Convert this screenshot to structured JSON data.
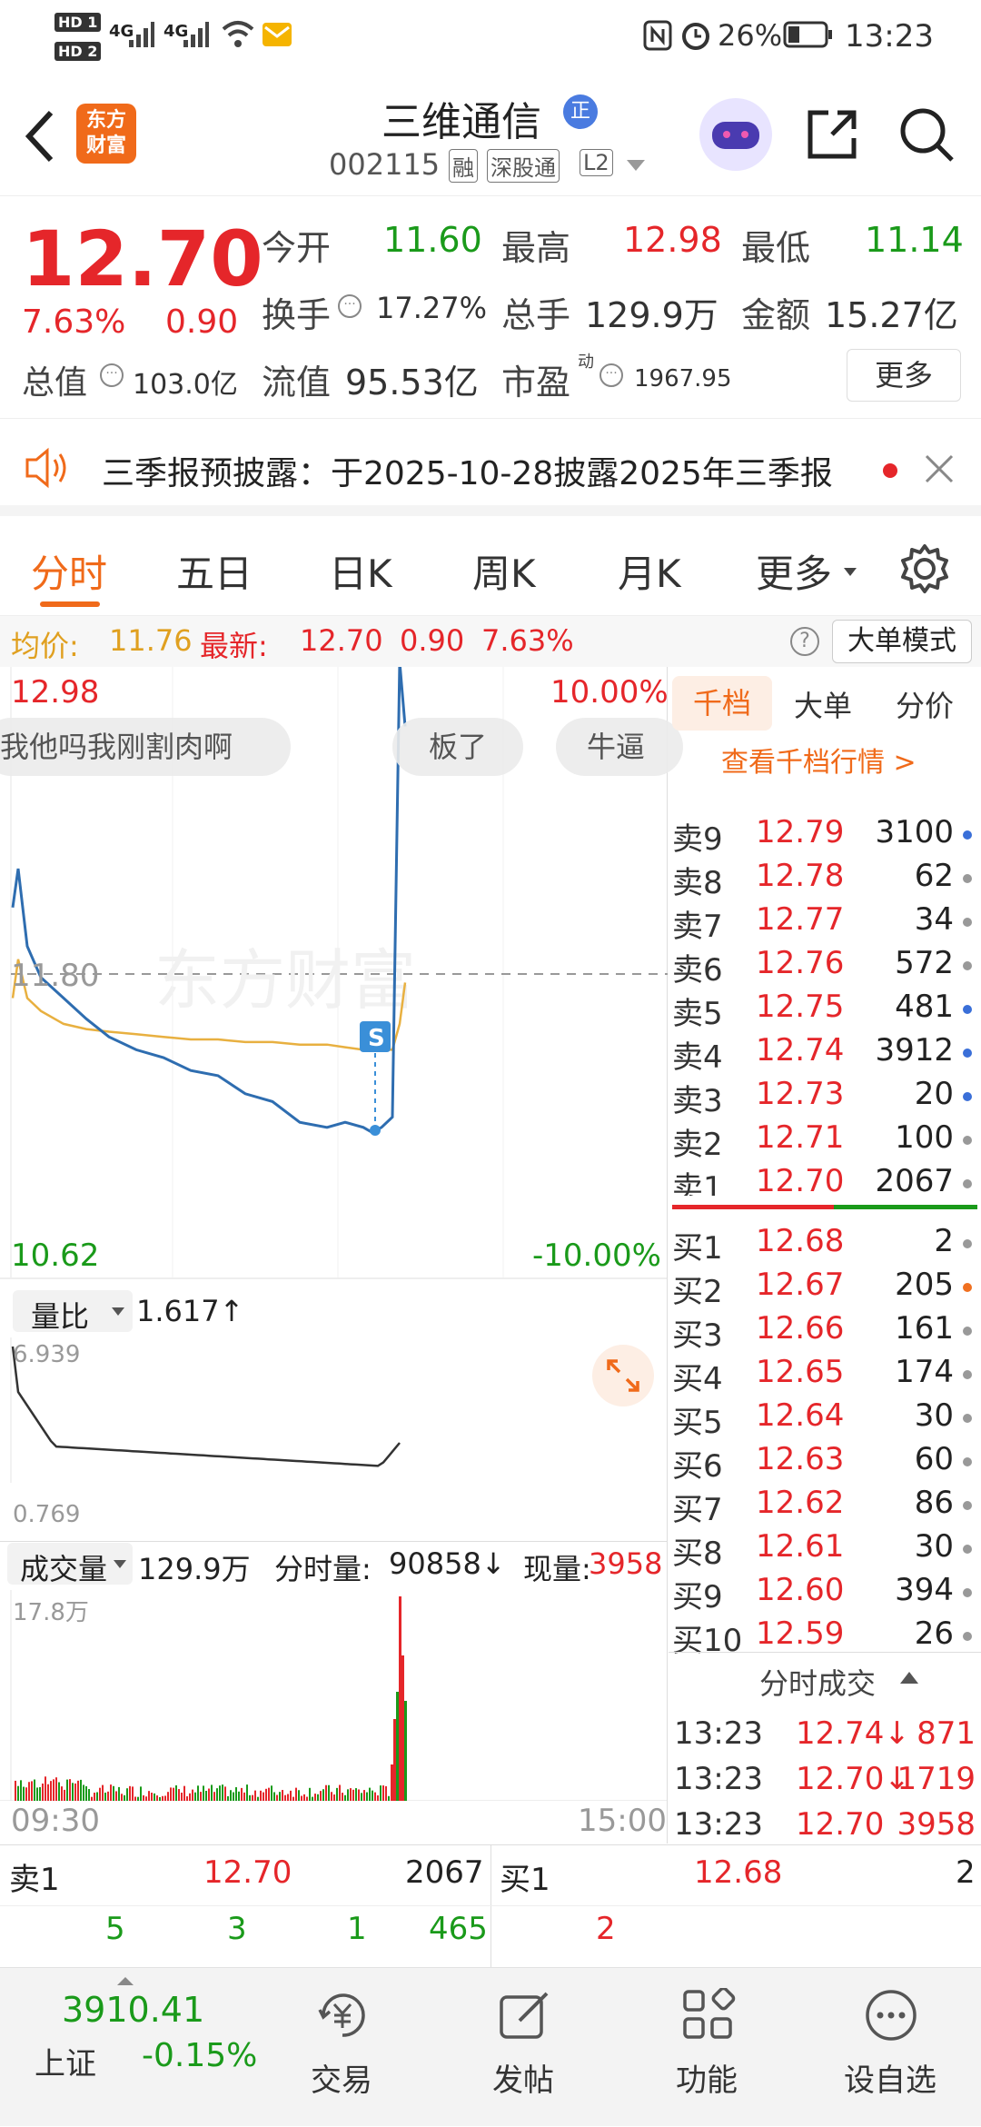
{
  "status_bar": {
    "hd1": "HD 1",
    "hd2": "HD 2",
    "net1": "4G",
    "net2": "4G",
    "battery": "26%",
    "time": "13:23"
  },
  "nav": {
    "logo_line1": "东方",
    "logo_line2": "财富",
    "stock_name": "三维通信",
    "badge": "正",
    "code": "002115",
    "tag1": "融",
    "tag2": "深股通",
    "tag3": "L2"
  },
  "quote": {
    "price": "12.70",
    "change_pct": "7.63%",
    "change_abs": "0.90",
    "open_label": "今开",
    "open": "11.60",
    "high_label": "最高",
    "high": "12.98",
    "low_label": "最低",
    "low": "11.14",
    "turnover_label": "换手",
    "turnover": "17.27%",
    "volume_label": "总手",
    "volume": "129.9万",
    "amount_label": "金额",
    "amount": "15.27亿",
    "mktcap_label": "总值",
    "mktcap": "103.0亿",
    "float_label": "流值",
    "float": "95.53亿",
    "pe_label": "市盈",
    "pe_sup": "动",
    "pe": "1967.95",
    "more_button": "更多"
  },
  "notice": {
    "text": "三季报预披露：于2025-10-28披露2025年三季报"
  },
  "tabs": {
    "items": [
      "分时",
      "五日",
      "日K",
      "周K",
      "月K",
      "更多"
    ],
    "active": "分时"
  },
  "infobar": {
    "avg_label": "均价:",
    "avg": "11.76",
    "latest_label": "最新:",
    "latest": "12.70",
    "chg": "0.90",
    "pct": "7.63%",
    "mode_button": "大单模式"
  },
  "chart": {
    "price_top": "12.98",
    "price_mid": "11.80",
    "price_bottom": "10.62",
    "pct_top": "10.00%",
    "pct_bottom": "-10.00%",
    "watermark": "东方财富",
    "bullets": [
      "我他吗我刚割肉啊",
      "板了",
      "牛逼"
    ],
    "trade_marker": "S",
    "ratio_label": "量比",
    "ratio_value": "1.617↑",
    "ratio_max": "6.939",
    "ratio_min": "0.769",
    "vol_label": "成交量",
    "vol_total": "129.9万",
    "tick_vol_label": "分时量:",
    "tick_vol": "90858↓",
    "cur_vol_label": "现量:",
    "cur_vol": "3958",
    "vol_max": "17.8万",
    "time_start": "09:30",
    "time_end": "15:00",
    "chart_data": {
      "type": "line",
      "series": [
        {
          "values": [
            12.05,
            12.2,
            11.9,
            11.78,
            11.7,
            11.62,
            11.55,
            11.5,
            11.47,
            11.42,
            11.4,
            11.33,
            11.3,
            11.22,
            11.2,
            11.22,
            11.2,
            11.18,
            11.2,
            11.24,
            13.0,
            12.75
          ]
        },
        {
          "values": [
            11.7,
            11.85,
            11.7,
            11.65,
            11.6,
            11.58,
            11.57,
            11.56,
            11.55,
            11.54,
            11.54,
            11.53,
            11.53,
            11.52,
            11.52,
            11.51,
            11.5,
            11.5,
            11.5,
            11.5,
            11.6,
            11.76
          ]
        }
      ],
      "ylim": [
        10.62,
        12.98
      ]
    }
  },
  "orderbook": {
    "tabs": [
      "千档",
      "大单",
      "分价"
    ],
    "link": "查看千档行情 >",
    "asks": [
      {
        "label": "卖9",
        "price": "12.79",
        "vol": "3100",
        "dot": "#3a6fd8"
      },
      {
        "label": "卖8",
        "price": "12.78",
        "vol": "62",
        "dot": "#999999"
      },
      {
        "label": "卖7",
        "price": "12.77",
        "vol": "34",
        "dot": "#999999"
      },
      {
        "label": "卖6",
        "price": "12.76",
        "vol": "572",
        "dot": "#999999"
      },
      {
        "label": "卖5",
        "price": "12.75",
        "vol": "481",
        "dot": "#3a6fd8"
      },
      {
        "label": "卖4",
        "price": "12.74",
        "vol": "3912",
        "dot": "#3a6fd8"
      },
      {
        "label": "卖3",
        "price": "12.73",
        "vol": "20",
        "dot": "#3a6fd8"
      },
      {
        "label": "卖2",
        "price": "12.71",
        "vol": "100",
        "dot": "#999999"
      },
      {
        "label": "卖1",
        "price": "12.70",
        "vol": "2067",
        "dot": "#999999"
      }
    ],
    "bids": [
      {
        "label": "买1",
        "price": "12.68",
        "vol": "2",
        "dot": "#999999"
      },
      {
        "label": "买2",
        "price": "12.67",
        "vol": "205",
        "dot": "#f07020"
      },
      {
        "label": "买3",
        "price": "12.66",
        "vol": "161",
        "dot": "#999999"
      },
      {
        "label": "买4",
        "price": "12.65",
        "vol": "174",
        "dot": "#999999"
      },
      {
        "label": "买5",
        "price": "12.64",
        "vol": "30",
        "dot": "#999999"
      },
      {
        "label": "买6",
        "price": "12.63",
        "vol": "60",
        "dot": "#999999"
      },
      {
        "label": "买7",
        "price": "12.62",
        "vol": "86",
        "dot": "#999999"
      },
      {
        "label": "买8",
        "price": "12.61",
        "vol": "30",
        "dot": "#999999"
      },
      {
        "label": "买9",
        "price": "12.60",
        "vol": "394",
        "dot": "#999999"
      },
      {
        "label": "买10",
        "price": "12.59",
        "vol": "26",
        "dot": "#999999"
      }
    ],
    "ticks_header": "分时成交",
    "ticks": [
      {
        "time": "13:23",
        "price": "12.74↓",
        "vol": "871"
      },
      {
        "time": "13:23",
        "price": "12.70↓",
        "vol": "1719"
      },
      {
        "time": "13:23",
        "price": "12.70",
        "vol": "3958"
      }
    ]
  },
  "bottom_info": {
    "left": {
      "label": "卖1",
      "price": "12.70",
      "vol": "2067",
      "nums": [
        "5",
        "3",
        "1",
        "465"
      ]
    },
    "right": {
      "label": "买1",
      "price": "12.68",
      "vol": "2",
      "nums": [
        "2"
      ]
    }
  },
  "bottom_nav": {
    "index_value": "3910.41",
    "index_name": "上证",
    "index_change": "-0.15%",
    "items": [
      "交易",
      "发帖",
      "功能",
      "设自选"
    ]
  }
}
